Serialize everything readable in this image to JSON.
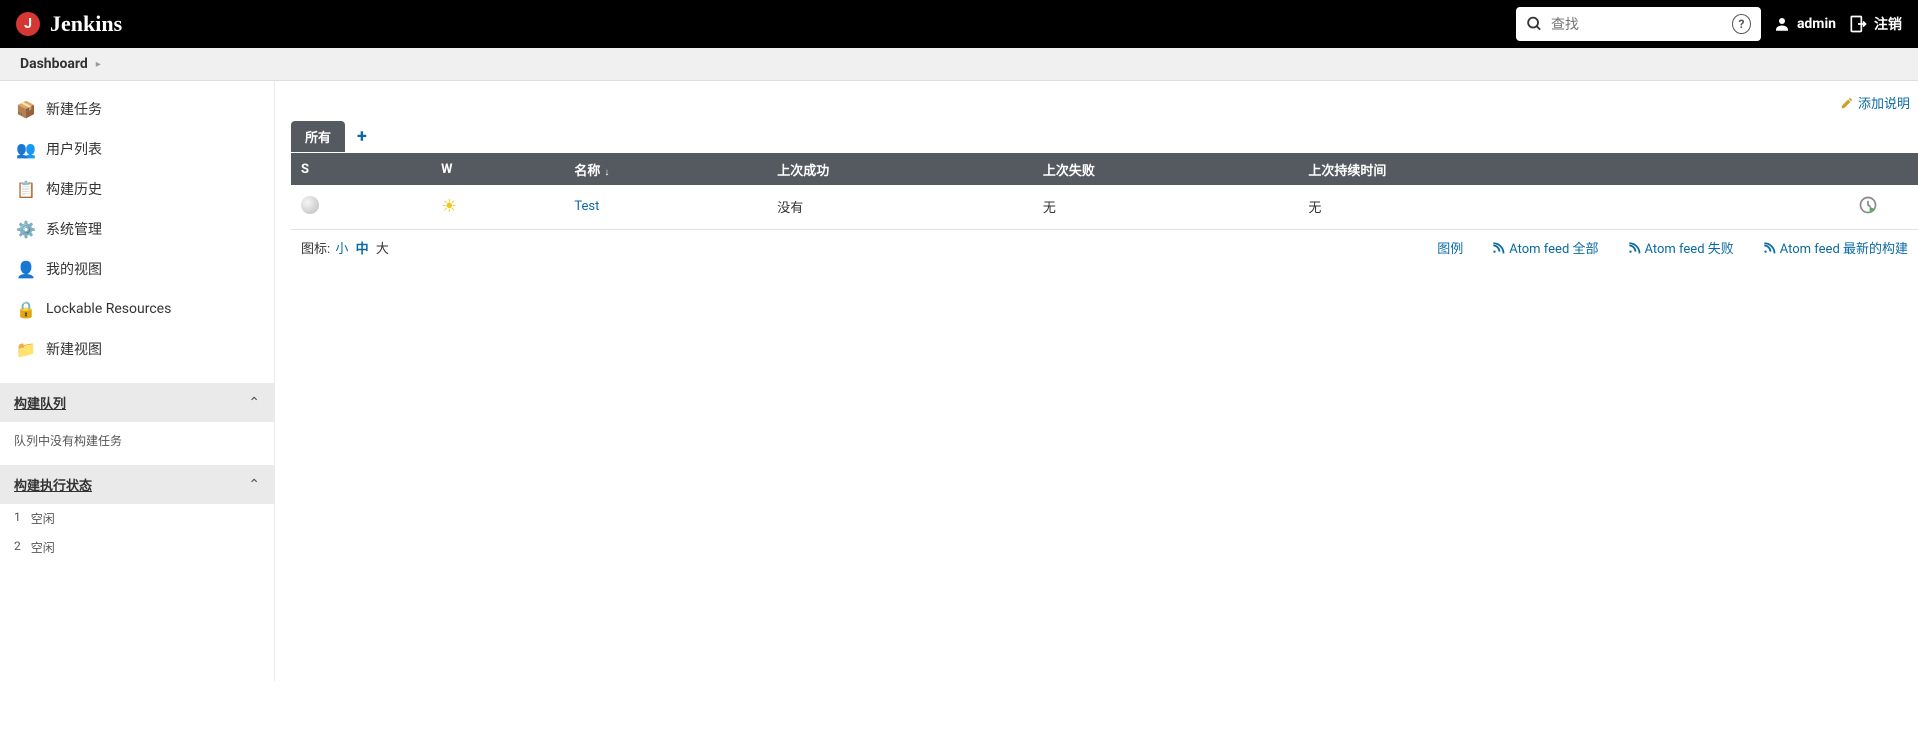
{
  "header": {
    "title": "Jenkins",
    "search_placeholder": "查找",
    "user": "admin",
    "logout": "注销"
  },
  "breadcrumbs": {
    "dashboard": "Dashboard"
  },
  "sidebar": {
    "items": [
      {
        "label": "新建任务"
      },
      {
        "label": "用户列表"
      },
      {
        "label": "构建历史"
      },
      {
        "label": "系统管理"
      },
      {
        "label": "我的视图"
      },
      {
        "label": "Lockable Resources"
      },
      {
        "label": "新建视图"
      }
    ],
    "queue": {
      "title": "构建队列",
      "empty": "队列中没有构建任务"
    },
    "executors": {
      "title": "构建执行状态",
      "rows": [
        {
          "num": "1",
          "status": "空闲"
        },
        {
          "num": "2",
          "status": "空闲"
        }
      ]
    }
  },
  "main": {
    "add_description": "添加说明",
    "tabs": {
      "all": "所有"
    },
    "columns": {
      "s": "S",
      "w": "W",
      "name": "名称",
      "last_success": "上次成功",
      "last_failure": "上次失败",
      "last_duration": "上次持续时间"
    },
    "jobs": [
      {
        "name": "Test",
        "last_success": "没有",
        "last_failure": "无",
        "last_duration": "无"
      }
    ],
    "icon_label": "图标:",
    "icon_sizes": {
      "small": "小",
      "medium": "中",
      "large": "大"
    },
    "legend": "图例",
    "feeds": {
      "all": "Atom feed 全部",
      "failed": "Atom feed 失败",
      "latest": "Atom feed 最新的构建"
    }
  }
}
